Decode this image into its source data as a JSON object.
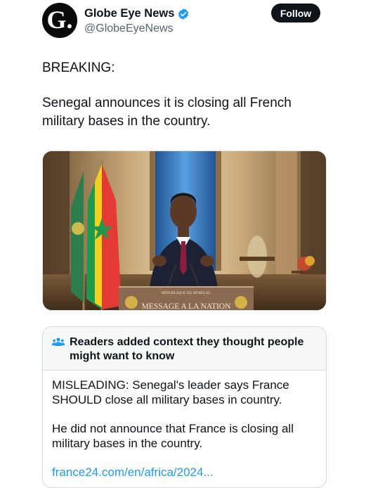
{
  "account": {
    "avatar_letter": "G.",
    "display_name": "Globe Eye News",
    "verified_icon": "verified-badge-icon",
    "handle": "@GlobeEyeNews",
    "follow_label": "Follow"
  },
  "tweet": {
    "line1": "BREAKING:",
    "line2": "Senegal announces it is closing all French military bases in the country."
  },
  "media": {
    "podium_line1": "RÉPUBLIQUE DU SÉNÉGAL",
    "podium_line2": "MESSAGE A LA NATION"
  },
  "community_note": {
    "icon": "people-icon",
    "title": "Readers added context they thought people might want to know",
    "paragraph1": "MISLEADING: Senegal's leader says France SHOULD close all military bases in country.",
    "paragraph2": "He did not announce that France is closing all military bases in the country.",
    "link": "france24.com/en/africa/2024..."
  },
  "colors": {
    "accent_link": "#1d9bf0",
    "follow_bg": "#0f1419",
    "verified": "#1d9bf0"
  }
}
